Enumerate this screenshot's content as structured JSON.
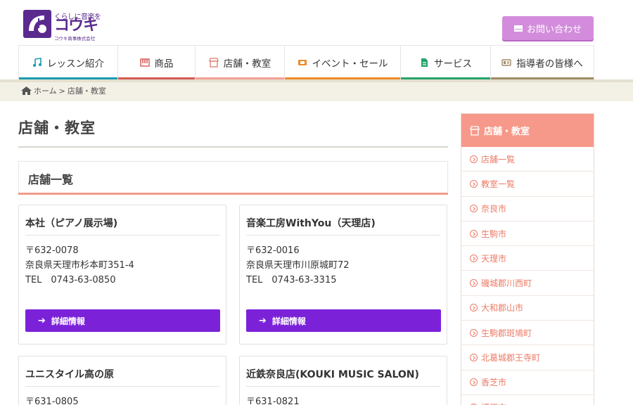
{
  "header": {
    "logo_tagline": "くらしに音楽を",
    "logo_name": "コウキ",
    "logo_company": "コウキ商事株式会社",
    "contact_label": "お問い合わせ"
  },
  "nav": {
    "items": [
      {
        "label": "レッスン紹介",
        "icon": "music-note-icon",
        "color": "#1a9bb0"
      },
      {
        "label": "商品",
        "icon": "piano-icon",
        "color": "#d45a54"
      },
      {
        "label": "店舗・教室",
        "icon": "shop-icon",
        "color": "#f4a093"
      },
      {
        "label": "イベント・セール",
        "icon": "ticket-icon",
        "color": "#ee8a2a"
      },
      {
        "label": "サービス",
        "icon": "document-icon",
        "color": "#25a36a"
      },
      {
        "label": "指導者の皆様へ",
        "icon": "id-card-icon",
        "color": "#a08a64"
      }
    ]
  },
  "breadcrumb": {
    "home": "ホーム",
    "separator": ">",
    "current": "店舗・教室"
  },
  "main": {
    "page_title": "店舗・教室",
    "section_title": "店舗一覧",
    "detail_label": "詳細情報",
    "cards": [
      {
        "name": "本社（ピアノ展示場)",
        "zip": "〒632-0078",
        "address": "奈良県天理市杉本町351-4",
        "tel": "TEL　0743-63-0850"
      },
      {
        "name": "音楽工房WithYou（天理店)",
        "zip": "〒632-0016",
        "address": "奈良県天理市川原城町72",
        "tel": "TEL　0743-63-3315"
      },
      {
        "name": "ユニスタイル高の原",
        "zip": "〒631-0805",
        "address": "",
        "tel": ""
      },
      {
        "name": "近鉄奈良店(KOUKI MUSIC SALON)",
        "zip": "〒631-0821",
        "address": "",
        "tel": ""
      }
    ]
  },
  "sidebar": {
    "heading": "店舗・教室",
    "items": [
      "店舗一覧",
      "教室一覧",
      "奈良市",
      "生駒市",
      "天理市",
      "磯城郡川西町",
      "大和郡山市",
      "生駒郡斑鳩町",
      "北葛城郡王寺町",
      "香芝市",
      "橿原市"
    ]
  },
  "colors": {
    "brand_purple": "#5a2a8f",
    "button_purple": "#7b22d9",
    "accent_salmon": "#f6998a",
    "contact_pink": "#d38cdc"
  }
}
